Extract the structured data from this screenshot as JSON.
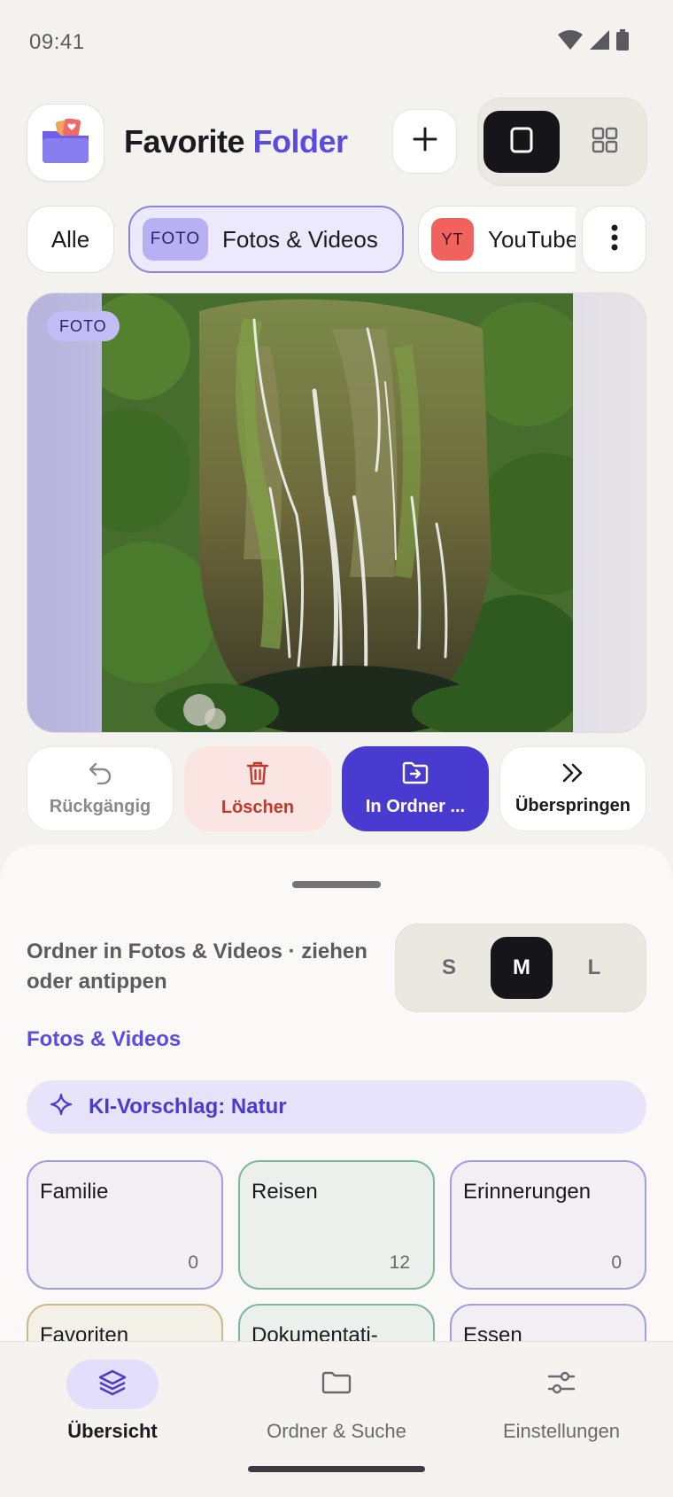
{
  "status_bar": {
    "time": "09:41"
  },
  "header": {
    "title_main": "Favorite",
    "title_accent": "Folder",
    "colors": {
      "accent": "#5b4ce0",
      "dark": "#16161a"
    }
  },
  "filters": {
    "all_label": "Alle",
    "photos": {
      "tag": "FOTO",
      "label": "Fotos & Videos"
    },
    "youtube": {
      "tag": "YT",
      "label": "YouTube"
    }
  },
  "media": {
    "badge": "FOTO"
  },
  "actions": {
    "undo": "Rückgängig",
    "delete": "Löschen",
    "move": "In Ordner ...",
    "skip": "Überspringen"
  },
  "sheet": {
    "description": "Ordner in Fotos & Videos · ziehen oder antippen",
    "sizes": [
      "S",
      "M",
      "L"
    ],
    "selected_size": "M",
    "breadcrumb": "Fotos & Videos",
    "ai_suggestion": "KI-Vorschlag: Natur",
    "folders": [
      {
        "name": "Familie",
        "count": "0"
      },
      {
        "name": "Reisen",
        "count": "12"
      },
      {
        "name": "Erinnerungen",
        "count": "0"
      },
      {
        "name": "Favoriten",
        "count": ""
      },
      {
        "name": "Dokumentati-",
        "count": ""
      },
      {
        "name": "Essen",
        "count": ""
      }
    ]
  },
  "nav": {
    "overview": "Übersicht",
    "folders_search": "Ordner & Suche",
    "settings": "Einstellungen",
    "active": "overview"
  }
}
